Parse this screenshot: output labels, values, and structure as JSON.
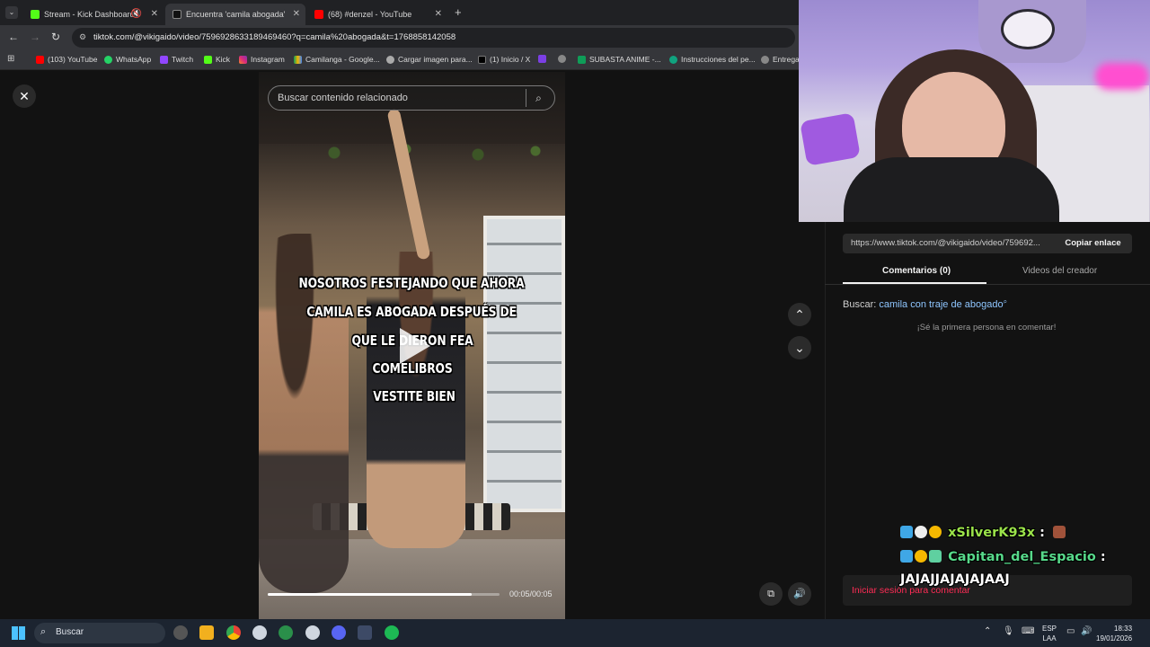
{
  "browser": {
    "tabs": [
      {
        "label": "Stream - Kick Dashboard",
        "active": false
      },
      {
        "label": "Encuentra 'camila abogada' en",
        "active": true
      },
      {
        "label": "(68) #denzel - YouTube",
        "active": false
      }
    ],
    "new_tab": "+",
    "url": "tiktok.com/@vikigaido/video/7596928633189469460?q=camila%20abogada&t=1768858142058",
    "bookmarks": [
      "(103) YouTube",
      "WhatsApp",
      "Twitch",
      "Kick",
      "Instagram",
      "Camilanga - Google...",
      "Cargar imagen para...",
      "(1) Inicio / X",
      "",
      "",
      "SUBASTA ANIME -...",
      "Instrucciones del pe...",
      "Entrega"
    ]
  },
  "tiktok": {
    "search_placeholder": "Buscar contenido relacionado",
    "caption_lines": [
      "NOSOTROS FESTEJANDO QUE AHORA",
      "CAMILA ES ABOGADA DESPUÉS DE",
      "QUE LE DIERON FEA",
      "COMELIBROS",
      "VESTITE BIEN"
    ],
    "time": "00:05/00:05",
    "progress": 0.88,
    "link": "https://www.tiktok.com/@vikigaido/video/759692...",
    "copy_label": "Copiar enlace",
    "tab_comments": "Comentarios (0)",
    "tab_creator": "Videos del creador",
    "search_label": "Buscar:",
    "search_link": "camila con traje de abogado",
    "first_comment": "¡Sé la primera persona en comentar!",
    "login": "Iniciar sesión para comentar"
  },
  "chat": [
    {
      "user": "xSilverK93x",
      "sep": ":",
      "message": ""
    },
    {
      "user": "Capitan_del_Espacio",
      "sep": ":",
      "message": "JAJAJJAJAJAJAAJ"
    }
  ],
  "taskbar": {
    "search": "Buscar",
    "lang": "ESP",
    "region": "LAA",
    "time": "18:33",
    "date": "19/01/2026"
  },
  "colors": {
    "chat_user_1": "#9be34a",
    "chat_user_2": "#57d98a",
    "tiktok_red": "#fe2c55",
    "link_blue": "#8fc6ff"
  }
}
